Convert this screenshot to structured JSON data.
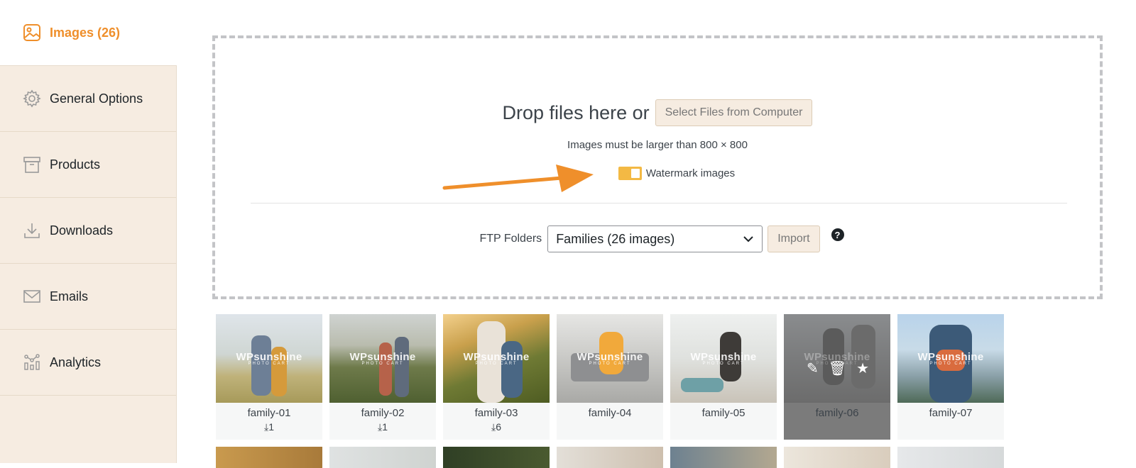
{
  "sidebar": {
    "active": {
      "label": "Images (26)",
      "icon": "image-icon"
    },
    "items": [
      {
        "label": "General Options",
        "icon": "gear-icon"
      },
      {
        "label": "Products",
        "icon": "archive-box-icon"
      },
      {
        "label": "Downloads",
        "icon": "download-icon"
      },
      {
        "label": "Emails",
        "icon": "envelope-icon"
      },
      {
        "label": "Analytics",
        "icon": "analytics-icon"
      }
    ]
  },
  "upload": {
    "drop_text": "Drop files here or",
    "select_button": "Select Files from Computer",
    "hint": "Images must be larger than 800 × 800",
    "watermark_label": "Watermark images",
    "watermark_on": true,
    "ftp_label": "FTP Folders",
    "ftp_selected": "Families (26 images)",
    "import_button": "Import",
    "help": "?"
  },
  "watermark_text": {
    "brand": "WPsunshine",
    "sub": "PHOTO CART"
  },
  "images": [
    {
      "name": "family-01",
      "downloads": "1"
    },
    {
      "name": "family-02",
      "downloads": "1"
    },
    {
      "name": "family-03",
      "downloads": "6"
    },
    {
      "name": "family-04",
      "downloads": ""
    },
    {
      "name": "family-05",
      "downloads": ""
    },
    {
      "name": "family-06",
      "downloads": ""
    },
    {
      "name": "family-07",
      "downloads": ""
    }
  ],
  "colors": {
    "accent": "#ef8f2b",
    "sidebar_bg": "#f6ece1",
    "toggle": "#f3b944"
  }
}
